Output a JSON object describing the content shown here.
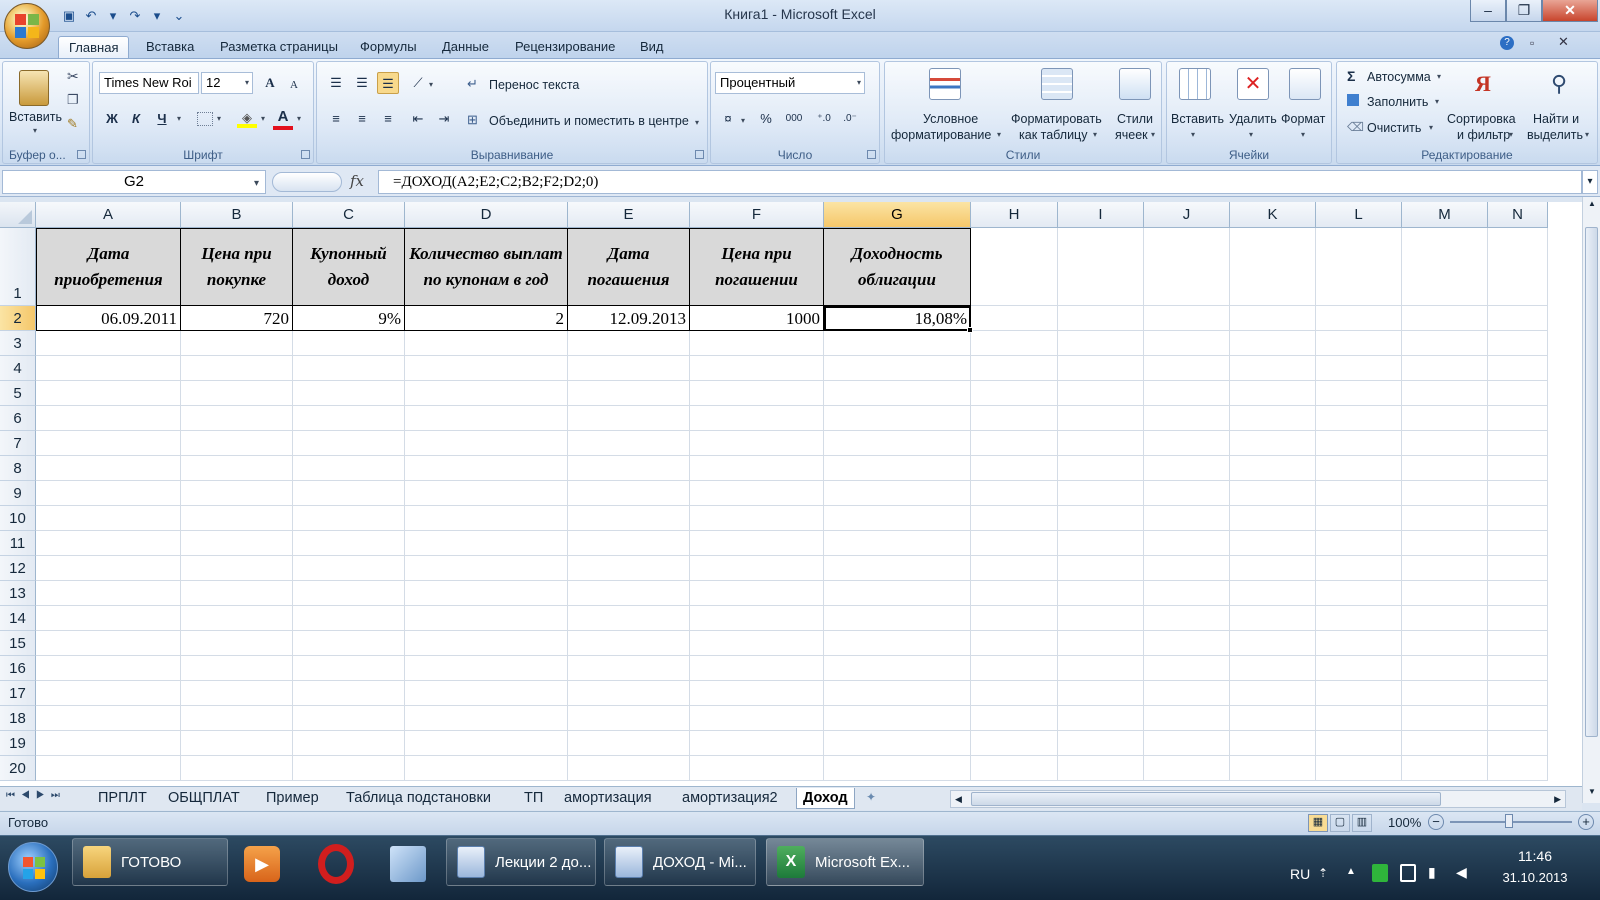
{
  "window": {
    "title": "Книга1 - Microsoft Excel",
    "minimize": "–",
    "maximize": "❐",
    "close": "✕"
  },
  "qat": {
    "save_icon": "save-icon",
    "undo_icon": "undo-icon",
    "redo_icon": "redo-icon",
    "customize_icon": "chevron-down-icon"
  },
  "tabs": [
    "Главная",
    "Вставка",
    "Разметка страницы",
    "Формулы",
    "Данные",
    "Рецензирование",
    "Вид"
  ],
  "ribbon": {
    "clipboard": {
      "paste": "Вставить",
      "label": "Буфер о..."
    },
    "font": {
      "name": "Times New Roi",
      "size": "12",
      "bold": "Ж",
      "italic": "К",
      "underline": "Ч",
      "grow": "A",
      "shrink": "A",
      "color_letter": "A",
      "label": "Шрифт"
    },
    "alignment": {
      "wrap": "Перенос текста",
      "merge": "Объединить и поместить в центре",
      "label": "Выравнивание"
    },
    "number": {
      "format": "Процентный",
      "percent": "%",
      "thousands": "000",
      "label": "Число"
    },
    "styles": {
      "conditional_1": "Условное",
      "conditional_2": "форматирование",
      "astable_1": "Форматировать",
      "astable_2": "как таблицу",
      "cellstyles_1": "Стили",
      "cellstyles_2": "ячеек",
      "label": "Стили"
    },
    "cells": {
      "insert": "Вставить",
      "delete": "Удалить",
      "format": "Формат",
      "label": "Ячейки"
    },
    "editing": {
      "autosum": "Автосумма",
      "fill": "Заполнить",
      "clear": "Очистить",
      "sort_1": "Сортировка",
      "sort_2": "и фильтр",
      "find_1": "Найти и",
      "find_2": "выделить",
      "label": "Редактирование"
    }
  },
  "formula_bar": {
    "name_box": "G2",
    "fx": "fx",
    "formula": "=ДОХОД(A2;E2;C2;B2;F2;D2;0)"
  },
  "columns": [
    "A",
    "B",
    "C",
    "D",
    "E",
    "F",
    "G",
    "H",
    "I",
    "J",
    "K",
    "L",
    "M",
    "N"
  ],
  "rows": [
    "1",
    "2",
    "3",
    "4",
    "5",
    "6",
    "7",
    "8",
    "9",
    "10",
    "11",
    "12",
    "13",
    "14",
    "15",
    "16",
    "17",
    "18",
    "19",
    "20"
  ],
  "sheet": {
    "headers": [
      "Дата приобретения",
      "Цена при покупке",
      "Купонный доход",
      "Количество выплат по купонам в год",
      "Дата погашения",
      "Цена при погашении",
      "Доходность облигации"
    ],
    "row2": [
      "06.09.2011",
      "720",
      "9%",
      "2",
      "12.09.2013",
      "1000",
      "18,08%"
    ]
  },
  "sheet_tabs": [
    "ПРПЛТ",
    "ОБЩПЛАТ",
    "Пример",
    "Таблица подстановки",
    "ТП",
    "амортизация",
    "амортизация2",
    "Доход"
  ],
  "status": {
    "ready": "Готово",
    "zoom": "100%",
    "zoom_out": "−",
    "zoom_in": "+"
  },
  "taskbar": {
    "items": [
      "ГОТОВО",
      "Лекции 2 до...",
      "ДОХОД - Mi...",
      "Microsoft Ex..."
    ],
    "lang": "RU",
    "time": "11:46",
    "date": "31.10.2013"
  },
  "colors": {
    "accent": "#f5c76a",
    "header_fill": "#d9d9d9",
    "excel_green": "#1d7a3a"
  }
}
